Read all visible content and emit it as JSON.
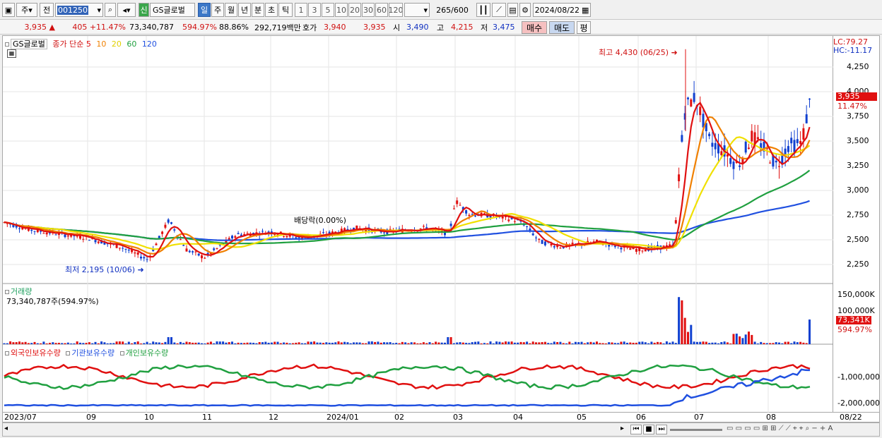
{
  "toolbar": {
    "period_main": "주",
    "prev": "전",
    "code": "001250",
    "badge": "신",
    "name": "GS글로벌",
    "periods": [
      "일",
      "주",
      "월",
      "년",
      "분",
      "초",
      "틱"
    ],
    "intervals": [
      "1",
      "3",
      "5",
      "10",
      "20",
      "30",
      "60",
      "120"
    ],
    "count": "265",
    "count_total": "/600",
    "date": "2024/08/22"
  },
  "info": {
    "price": "3,935",
    "change": "405",
    "change_pct": "+11.47%",
    "volume": "73,340,787",
    "volume_pct": "594.97%",
    "ratio": "88.86%",
    "amount": "292,719백만",
    "hoga_label": "호가",
    "ask": "3,940",
    "bid": "3,935",
    "open_label": "시",
    "open": "3,490",
    "high_label": "고",
    "high": "4,215",
    "low_label": "저",
    "low": "3,475",
    "buy": "매수",
    "sell": "매도",
    "avg": "평"
  },
  "price_panel": {
    "stock_label": "GS글로벌",
    "ma_title": "종가 단순",
    "ma_periods": [
      "5",
      "10",
      "20",
      "60",
      "120"
    ],
    "ma_colors": [
      "#e01010",
      "#f08000",
      "#f0e000",
      "#20a040",
      "#2050e0"
    ],
    "high_marker": "최고 4,430 (06/25)",
    "low_marker": "최저 2,195 (10/06)",
    "dividend": "배당락(0.00%)",
    "lc": "LC:79.27",
    "hc": "HC:-11.17",
    "y_ticks": [
      "4,250",
      "4,000",
      "3,750",
      "3,500",
      "3,250",
      "3,000",
      "2,750",
      "2,500",
      "2,250"
    ],
    "current_price_tag": "3,935",
    "current_pct": "11.47%"
  },
  "volume_panel": {
    "title": "거래량",
    "value": "73,340,787주(594.97%)",
    "y_ticks": [
      "150,000K",
      "100,000K"
    ],
    "current_tag": "73,341K",
    "current_pct": "594.97%"
  },
  "holding_panel": {
    "series_names": [
      "외국인보유수량",
      "기관보유수량",
      "개인보유수량"
    ],
    "series_colors": [
      "#e01010",
      "#2050e0",
      "#20a040"
    ],
    "y_ticks": [
      "-1,000,000",
      "-2,000,000"
    ]
  },
  "x_axis": {
    "labels": [
      "2023/07",
      "09",
      "10",
      "11",
      "12",
      "2024/01",
      "02",
      "03",
      "04",
      "05",
      "06",
      "07",
      "08"
    ],
    "right_label": "08/22"
  }
}
